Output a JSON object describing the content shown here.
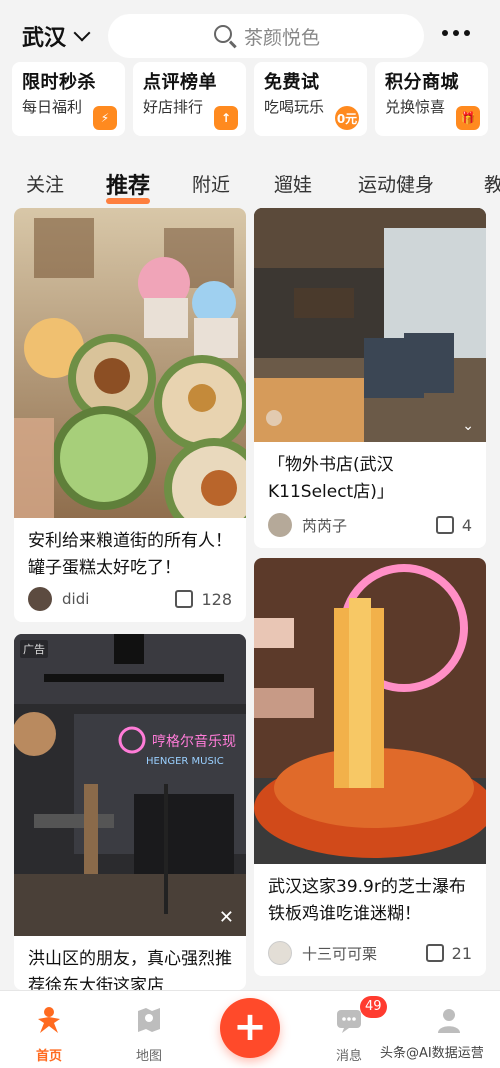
{
  "header": {
    "city": "武汉",
    "search_placeholder": "茶颜悦色"
  },
  "promos": [
    {
      "title": "限时秒杀",
      "subtitle": "每日福利",
      "badge": "⚡"
    },
    {
      "title": "点评榜单",
      "subtitle": "好店排行",
      "badge": "↑"
    },
    {
      "title": "免费试",
      "subtitle": "吃喝玩乐",
      "badge": "0元"
    },
    {
      "title": "积分商城",
      "subtitle": "兑换惊喜",
      "badge": "🎁"
    }
  ],
  "tabs": [
    "关注",
    "推荐",
    "附近",
    "遛娃",
    "运动健身",
    "教"
  ],
  "feed": {
    "left": [
      {
        "title": "安利给来粮道街的所有人！罐子蛋糕太好吃了！",
        "author": "didi",
        "likes": "128",
        "ad": ""
      },
      {
        "title": "洪山区的朋友，真心强烈推荐徐东大街这家店",
        "author": "",
        "likes": "",
        "ad": "广告",
        "sign": "哼格尔音乐现"
      }
    ],
    "right": [
      {
        "title": "「物外书店(武汉K11Select店)」",
        "author": "芮芮子",
        "likes": "4"
      },
      {
        "title": "武汉这家39.9r的芝士瀑布铁板鸡谁吃谁迷糊！",
        "author": "十三可可栗",
        "likes": "21"
      }
    ]
  },
  "bottomnav": {
    "home": "首页",
    "map": "地图",
    "plus": "+",
    "messages": "消息",
    "messages_badge": "49",
    "me": ""
  },
  "watermark": "头条@AI数据运营",
  "colors": {
    "accent": "#ff6a1f",
    "plus": "#ff4a2a",
    "badge": "#ff3b2f"
  }
}
